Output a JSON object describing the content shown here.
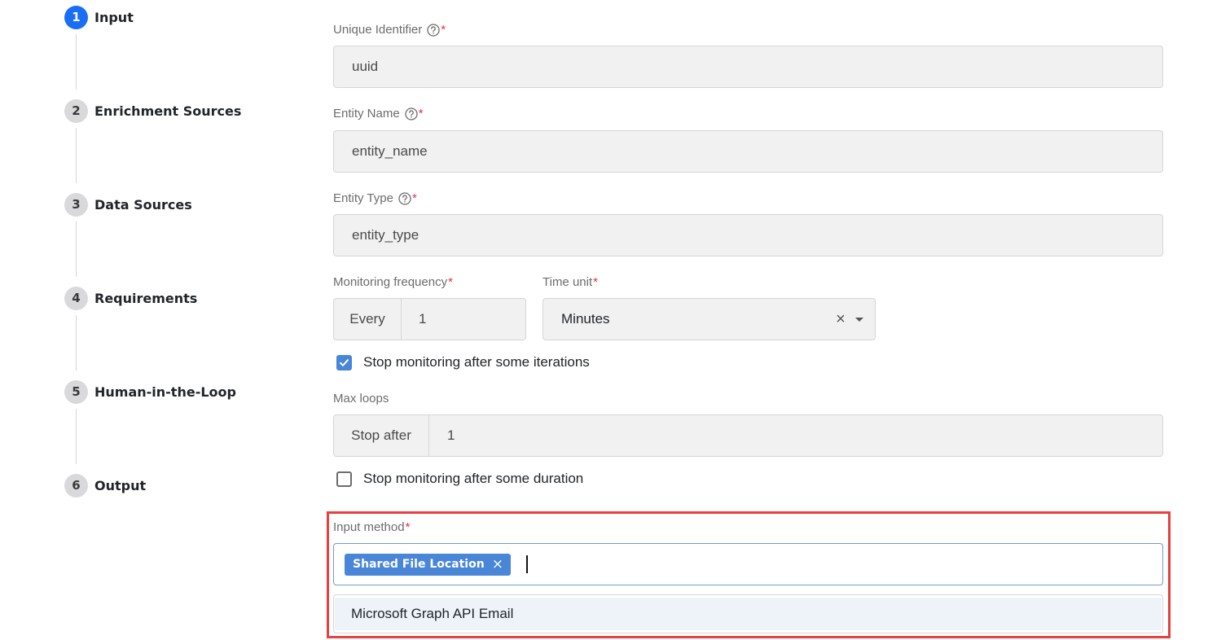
{
  "stepper": {
    "steps": [
      {
        "number": "1",
        "label": "Input"
      },
      {
        "number": "2",
        "label": "Enrichment Sources"
      },
      {
        "number": "3",
        "label": "Data Sources"
      },
      {
        "number": "4",
        "label": "Requirements"
      },
      {
        "number": "5",
        "label": "Human-in-the-Loop"
      },
      {
        "number": "6",
        "label": "Output"
      }
    ],
    "active_step": "1"
  },
  "form": {
    "required_marker": "*",
    "unique_identifier": {
      "label": "Unique Identifier",
      "value": "uuid",
      "help_icon": "question-circle-icon"
    },
    "entity_name": {
      "label": "Entity Name",
      "value": "entity_name",
      "help_icon": "question-circle-icon"
    },
    "entity_type": {
      "label": "Entity Type",
      "value": "entity_type",
      "help_icon": "question-circle-icon"
    },
    "monitoring_frequency": {
      "label": "Monitoring frequency",
      "prefix": "Every",
      "value": "1"
    },
    "time_unit": {
      "label": "Time unit",
      "value": "Minutes",
      "clear_symbol": "×"
    },
    "stop_after_iterations": {
      "label": "Stop monitoring after some iterations",
      "checked": true
    },
    "max_loops": {
      "label": "Max loops",
      "prefix": "Stop after",
      "value": "1"
    },
    "stop_after_duration": {
      "label": "Stop monitoring after some duration",
      "checked": false
    },
    "input_method": {
      "label": "Input method",
      "selected": [
        {
          "label": "Shared File Location",
          "remove_symbol": "×"
        }
      ],
      "options": [
        "Microsoft Graph API Email"
      ]
    }
  },
  "colors": {
    "accent": "#1a6ef5",
    "chip": "#4a86d8",
    "highlight_border": "#e8403f",
    "required": "#dc3545"
  }
}
